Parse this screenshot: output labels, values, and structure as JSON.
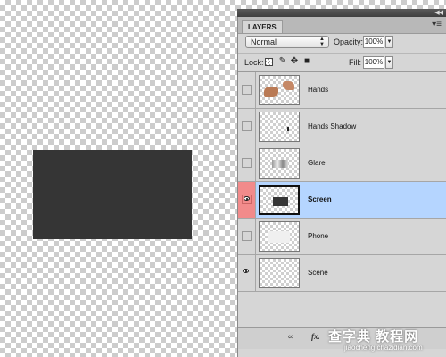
{
  "panel": {
    "tab_label": "LAYERS",
    "menu_icon": "panel-menu-icon",
    "collapse_icon": "collapse-icon"
  },
  "blend": {
    "mode": "Normal",
    "opacity_label": "Opacity:",
    "opacity_value": "100%"
  },
  "lock": {
    "label": "Lock:",
    "fill_label": "Fill:",
    "fill_value": "100%"
  },
  "layers": [
    {
      "name": "Hands",
      "visible": false,
      "selected": false
    },
    {
      "name": "Hands Shadow",
      "visible": false,
      "selected": false
    },
    {
      "name": "Glare",
      "visible": false,
      "selected": false
    },
    {
      "name": "Screen",
      "visible": true,
      "selected": true
    },
    {
      "name": "Phone",
      "visible": false,
      "selected": false
    },
    {
      "name": "Scene",
      "visible": true,
      "selected": false
    }
  ],
  "footer": {
    "link_icon": "link-layers-icon",
    "fx_label": "fx."
  },
  "watermark": {
    "text": "查字典 教程网",
    "url": "jiaocheng.chazidian.com"
  },
  "colors": {
    "screen_fill": "#353535",
    "selected_row": "#b5d5ff",
    "visibility_highlight": "#f28b8b"
  }
}
